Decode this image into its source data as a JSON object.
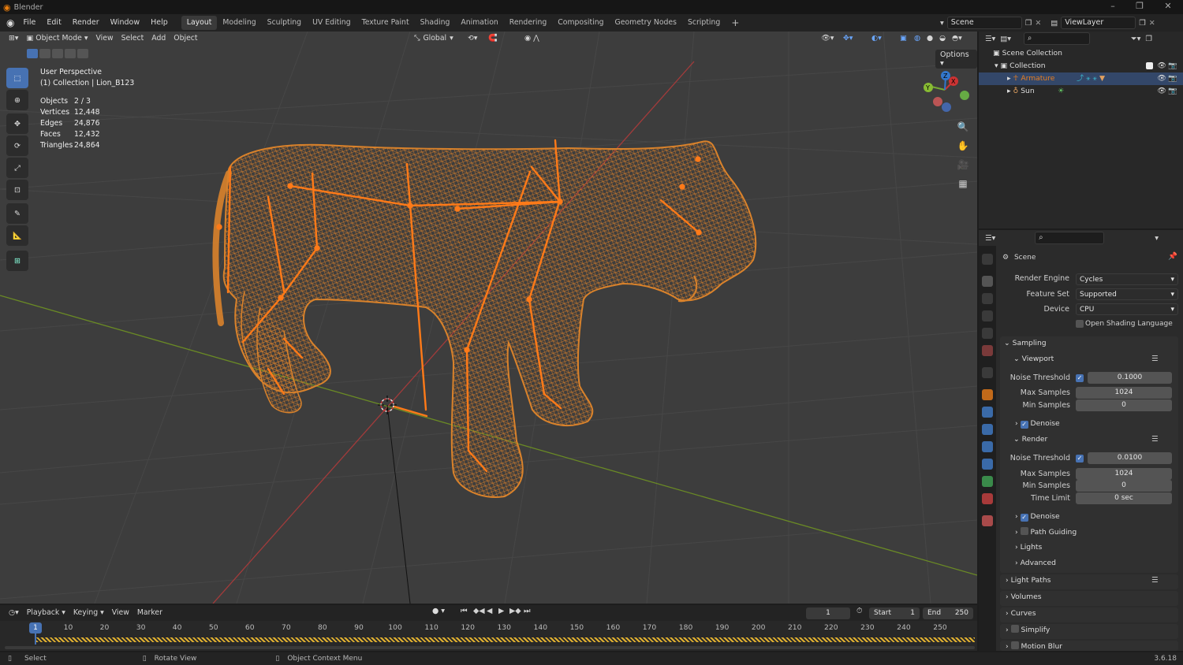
{
  "app": {
    "title": "Blender",
    "version": "3.6.18"
  },
  "menus": [
    "File",
    "Edit",
    "Render",
    "Window",
    "Help"
  ],
  "workspaces": [
    "Layout",
    "Modeling",
    "Sculpting",
    "UV Editing",
    "Texture Paint",
    "Shading",
    "Animation",
    "Rendering",
    "Compositing",
    "Geometry Nodes",
    "Scripting"
  ],
  "active_workspace": "Layout",
  "scene_field": "Scene",
  "viewlayer_field": "ViewLayer",
  "viewport": {
    "mode": "Object Mode",
    "header_menus": [
      "View",
      "Select",
      "Add",
      "Object"
    ],
    "transform_orientation": "Global",
    "options_label": "Options",
    "overlay_title": "User Perspective",
    "overlay_subtitle": "(1) Collection | Lion_B123",
    "stats": [
      {
        "label": "Objects",
        "value": "2 / 3"
      },
      {
        "label": "Vertices",
        "value": "12,448"
      },
      {
        "label": "Edges",
        "value": "24,876"
      },
      {
        "label": "Faces",
        "value": "12,432"
      },
      {
        "label": "Triangles",
        "value": "24,864"
      }
    ],
    "gizmo_axes": [
      "X",
      "Y",
      "Z"
    ],
    "wire_color": "#d9822b",
    "bone_color": "#ff7a18"
  },
  "outliner": {
    "search_placeholder": "",
    "items": [
      {
        "label": "Scene Collection"
      },
      {
        "label": "Collection"
      },
      {
        "label": "Armature",
        "color": "#e67e22"
      },
      {
        "label": "Sun"
      }
    ]
  },
  "properties": {
    "context": "Scene",
    "render_engine_label": "Render Engine",
    "render_engine": "Cycles",
    "feature_set_label": "Feature Set",
    "feature_set": "Supported",
    "device_label": "Device",
    "device": "CPU",
    "osl_label": "Open Shading Language",
    "sampling": "Sampling",
    "viewport_sub": "Viewport",
    "noise_threshold_label": "Noise Threshold",
    "viewport_noise": "0.1000",
    "max_samples_label": "Max Samples",
    "viewport_max": "1024",
    "min_samples_label": "Min Samples",
    "viewport_min": "0",
    "denoise_label": "Denoise",
    "render_sub": "Render",
    "render_noise": "0.0100",
    "render_max": "1024",
    "render_min": "0",
    "time_limit_label": "Time Limit",
    "time_limit": "0 sec",
    "path_guiding": "Path Guiding",
    "lights": "Lights",
    "advanced": "Advanced",
    "sections": [
      "Light Paths",
      "Volumes",
      "Curves",
      "Simplify",
      "Motion Blur"
    ]
  },
  "timeline": {
    "menus": [
      "Playback",
      "Keying",
      "View",
      "Marker"
    ],
    "current_frame": "1",
    "start_label": "Start",
    "start": "1",
    "end_label": "End",
    "end": "250",
    "ticks": [
      "1",
      "10",
      "20",
      "30",
      "40",
      "50",
      "60",
      "70",
      "80",
      "90",
      "100",
      "110",
      "120",
      "130",
      "140",
      "150",
      "160",
      "170",
      "180",
      "190",
      "200",
      "210",
      "220",
      "230",
      "240",
      "250"
    ]
  },
  "status": {
    "select": "Select",
    "rotate": "Rotate View",
    "context_menu": "Object Context Menu"
  }
}
